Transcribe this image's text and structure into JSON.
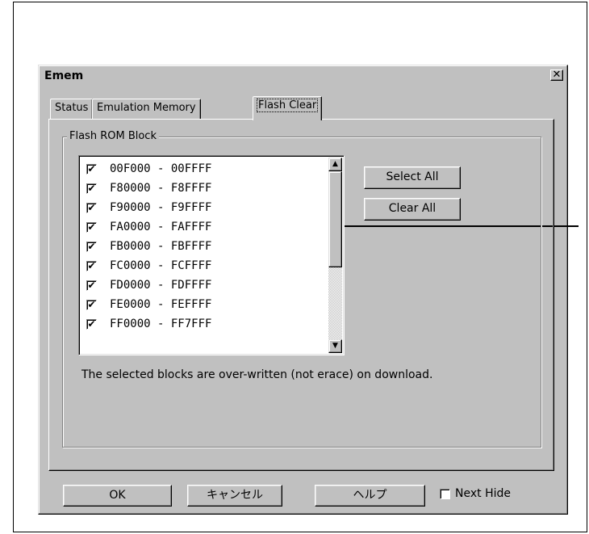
{
  "dialog": {
    "title": "Emem",
    "close_glyph": "✕"
  },
  "tabs": [
    {
      "label": "Status",
      "active": false
    },
    {
      "label": "Emulation Memory",
      "active": false
    },
    {
      "label": "Flash Clear",
      "active": true
    }
  ],
  "group": {
    "label": "Flash ROM Block"
  },
  "blocks": [
    {
      "range": "00F000  -  00FFFF",
      "checked": true
    },
    {
      "range": "F80000  -  F8FFFF",
      "checked": true
    },
    {
      "range": "F90000  -  F9FFFF",
      "checked": true
    },
    {
      "range": "FA0000  -  FAFFFF",
      "checked": true
    },
    {
      "range": "FB0000  -  FBFFFF",
      "checked": true
    },
    {
      "range": "FC0000  -  FCFFFF",
      "checked": true
    },
    {
      "range": "FD0000  -  FDFFFF",
      "checked": true
    },
    {
      "range": "FE0000  -  FEFFFF",
      "checked": true
    },
    {
      "range": "FF0000  -  FF7FFF",
      "checked": true
    }
  ],
  "check_glyph": "✔",
  "buttons": {
    "select_all": "Select All",
    "clear_all": "Clear All",
    "ok": "OK",
    "cancel": "キャンセル",
    "help": "ヘルプ"
  },
  "note": "The selected blocks are over-written (not erace) on download.",
  "next_hide": {
    "label": "Next Hide",
    "checked": false
  },
  "icons": {
    "scroll_up": "▲",
    "scroll_down": "▼"
  }
}
